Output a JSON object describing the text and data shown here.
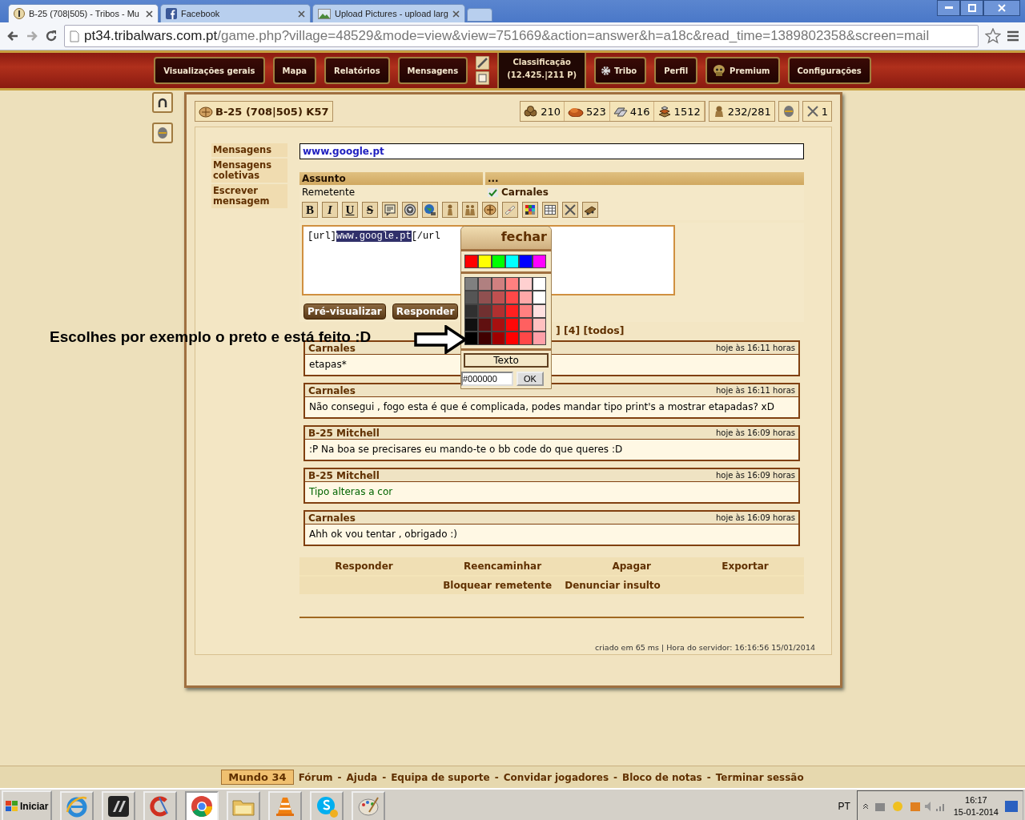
{
  "browser": {
    "tabs": [
      {
        "title": "B-25 (708|505) - Tribos - Mu",
        "kind": "game",
        "selected": true
      },
      {
        "title": "Facebook",
        "kind": "facebook",
        "selected": false
      },
      {
        "title": "Upload Pictures - upload larg",
        "kind": "picture",
        "selected": false
      }
    ],
    "url_host": "pt34.tribalwars.com.pt",
    "url_path": "/game.php?village=48529&mode=view&view=751669&action=answer&h=a18c&read_time=1389802358&screen=mail"
  },
  "game_nav": {
    "left": [
      {
        "label": "Visualizações gerais",
        "kind": "plain"
      },
      {
        "label": "Mapa",
        "kind": "plain"
      },
      {
        "label": "Relatórios",
        "kind": "plain"
      },
      {
        "label": "Mensagens",
        "kind": "plain"
      }
    ],
    "ranking": {
      "label": "Classificação",
      "value": "(12.425.|211 P)"
    },
    "right": [
      {
        "label": "Tribo",
        "kind": "tribe"
      },
      {
        "label": "Perfil",
        "kind": "plain"
      },
      {
        "label": "Premium",
        "kind": "premium"
      },
      {
        "label": "Configurações",
        "kind": "plain"
      }
    ]
  },
  "village": {
    "name": "B-25 (708|505) K57"
  },
  "resources": [
    {
      "kind": "wood",
      "value": "210"
    },
    {
      "kind": "clay",
      "value": "523"
    },
    {
      "kind": "iron",
      "value": "416"
    },
    {
      "kind": "storage",
      "value": "1512"
    }
  ],
  "population": "232/281",
  "attacks": "1",
  "sidebar": {
    "items": [
      "Mensagens",
      "Mensagens coletivas",
      "Escrever mensagem"
    ]
  },
  "subject_field": {
    "value": "www.google.pt"
  },
  "header_table": {
    "columns": [
      "Assunto",
      "..."
    ],
    "sender_label": "Remetente",
    "sender": "Carnales",
    "sender_checked": true
  },
  "format_buttons": [
    "B",
    "I",
    "U",
    "S"
  ],
  "editor": {
    "before": "[url]",
    "selected_text": "www.google.pt",
    "after": "[/url"
  },
  "form_buttons": [
    "Pré-visualizar",
    "Responder"
  ],
  "color_picker": {
    "close": "fechar",
    "palette": [
      {
        "color": "#ff0000"
      },
      {
        "color": "#ffff00"
      },
      {
        "color": "#00ff00"
      },
      {
        "color": "#00ffff"
      },
      {
        "color": "#0000ff"
      },
      {
        "color": "#ff00ff"
      }
    ],
    "grid": [
      {
        "cells": [
          {
            "color": "#808080"
          },
          {
            "color": "#b08080"
          },
          {
            "color": "#d08080"
          },
          {
            "color": "#ff8080"
          },
          {
            "color": "#ffd0d0"
          },
          {
            "color": "#ffffff"
          }
        ]
      },
      {
        "cells": [
          {
            "color": "#555555"
          },
          {
            "color": "#905050"
          },
          {
            "color": "#c05050"
          },
          {
            "color": "#ff4848"
          },
          {
            "color": "#ffa8a8"
          },
          {
            "color": "#ffffff"
          }
        ]
      },
      {
        "cells": [
          {
            "color": "#303030"
          },
          {
            "color": "#703030"
          },
          {
            "color": "#b03030"
          },
          {
            "color": "#ff2020"
          },
          {
            "color": "#ff8080"
          },
          {
            "color": "#ffe0e0"
          }
        ]
      },
      {
        "cells": [
          {
            "color": "#101010"
          },
          {
            "color": "#601010"
          },
          {
            "color": "#a81010"
          },
          {
            "color": "#ff0808"
          },
          {
            "color": "#ff6060"
          },
          {
            "color": "#ffc0c0"
          }
        ]
      },
      {
        "cells": [
          {
            "color": "#000000"
          },
          {
            "color": "#400000"
          },
          {
            "color": "#a00000"
          },
          {
            "color": "#ff0000"
          },
          {
            "color": "#ff4848"
          },
          {
            "color": "#ffa0a8"
          }
        ]
      }
    ],
    "mode_label": "Texto",
    "value": "#000000",
    "ok": "OK"
  },
  "thread_links": "] [4] [todos]",
  "messages": [
    {
      "author": "Carnales",
      "time": "hoje às 16:11 horas",
      "body": "etapas*",
      "color": "#000000"
    },
    {
      "author": "Carnales",
      "time": "hoje às 16:11 horas",
      "body": "Não consegui , fogo esta é que é complicada, podes mandar tipo print's a mostrar etapadas? xD",
      "color": "#000000"
    },
    {
      "author": "B-25 Mitchell",
      "time": "hoje às 16:09 horas",
      "body": ":P Na boa se precisares eu mando-te o bb code do que queres :D",
      "color": "#000000"
    },
    {
      "author": "B-25 Mitchell",
      "time": "hoje às 16:09 horas",
      "body": "Tipo alteras a cor",
      "color": "#006400"
    },
    {
      "author": "Carnales",
      "time": "hoje às 16:09 horas",
      "body": "Ahh ok vou tentar , obrigado :)",
      "color": "#000000"
    }
  ],
  "actions": [
    [
      "Responder",
      "Reencaminhar",
      "Apagar",
      "Exportar"
    ],
    [
      "Bloquear remetente",
      "Denunciar insulto"
    ]
  ],
  "server_info": "criado em 65 ms | Hora do servidor: 16:16:56 15/01/2014",
  "annotation": "Escolhes por exemplo o preto e está feito :D",
  "bottom_bar": {
    "world": "Mundo 34",
    "separator": "-",
    "links": [
      "Fórum",
      "Ajuda",
      "Equipa de suporte",
      "Convidar jogadores",
      "Bloco de notas",
      "Terminar sessão"
    ]
  },
  "taskbar": {
    "start": "Iniciar",
    "apps": [
      {
        "kind": "ie",
        "selected": false
      },
      {
        "kind": "dark",
        "selected": false
      },
      {
        "kind": "ccleaner",
        "selected": false
      },
      {
        "kind": "chrome",
        "selected": true
      },
      {
        "kind": "folder",
        "selected": false
      },
      {
        "kind": "vlc",
        "selected": false
      },
      {
        "kind": "skype",
        "selected": false
      },
      {
        "kind": "paint",
        "selected": false
      }
    ],
    "language": "PT",
    "time": "16:17",
    "date": "15-01-2014"
  }
}
